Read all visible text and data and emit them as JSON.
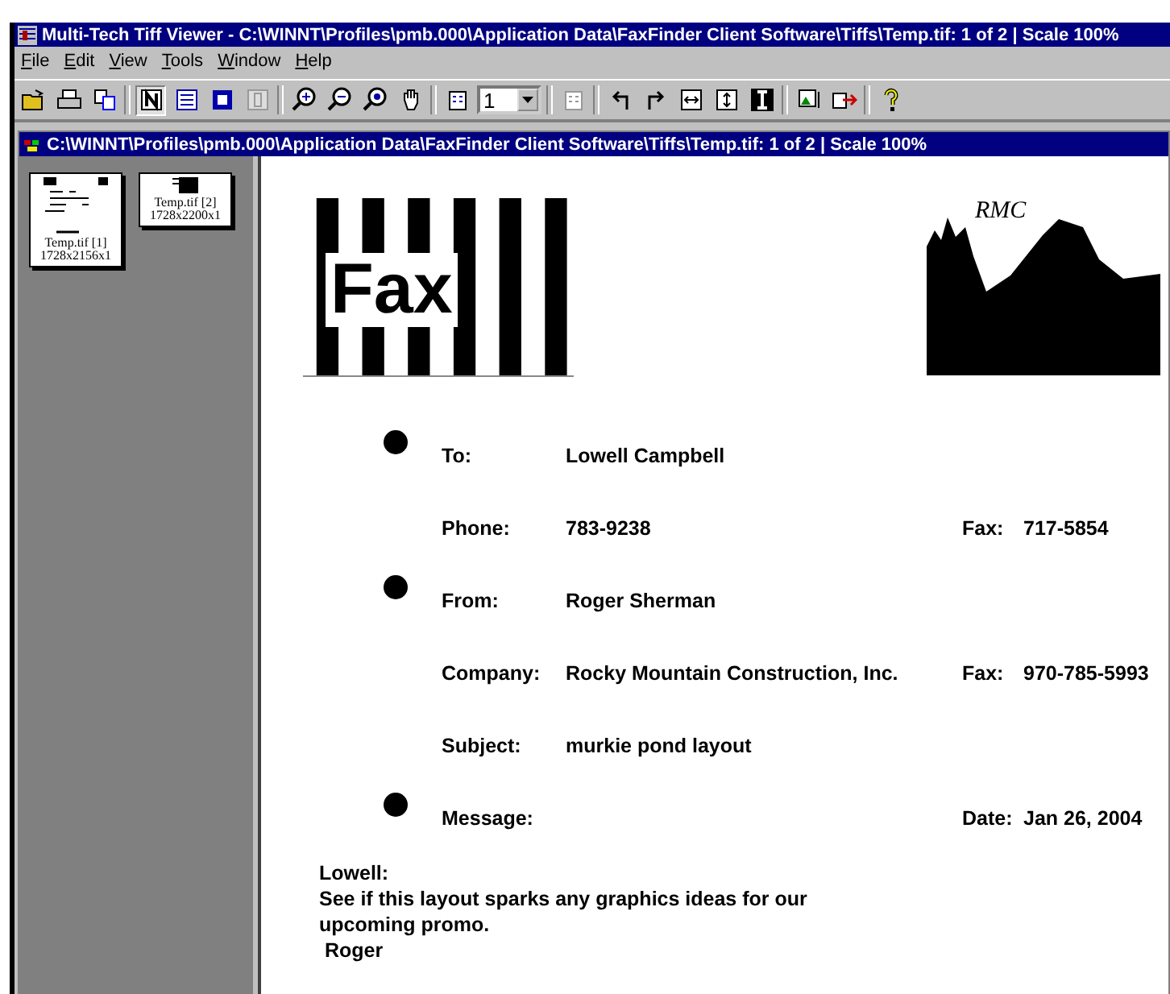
{
  "window": {
    "title": "Multi-Tech Tiff Viewer - C:\\WINNT\\Profiles\\pmb.000\\Application Data\\FaxFinder Client Software\\Tiffs\\Temp.tif: 1 of 2 | Scale 100%"
  },
  "menu": [
    "File",
    "Edit",
    "View",
    "Tools",
    "Window",
    "Help"
  ],
  "toolbar": [
    {
      "kind": "open"
    },
    {
      "kind": "print"
    },
    {
      "kind": "copy"
    },
    {
      "kind": "sep"
    },
    {
      "kind": "normal",
      "selected": true
    },
    {
      "kind": "fitwidth",
      "selected": false
    },
    {
      "kind": "fitpage",
      "selected": false
    },
    {
      "kind": "fitheight",
      "selected": false
    },
    {
      "kind": "sep"
    },
    {
      "kind": "zoomin"
    },
    {
      "kind": "zoomout"
    },
    {
      "kind": "zoomall"
    },
    {
      "kind": "hand"
    },
    {
      "kind": "sep"
    },
    {
      "kind": "pages"
    },
    {
      "kind": "combo",
      "value": "1"
    },
    {
      "kind": "sep"
    },
    {
      "kind": "pagesdisabled"
    },
    {
      "kind": "sep"
    },
    {
      "kind": "rotleft"
    },
    {
      "kind": "rotright"
    },
    {
      "kind": "fliph"
    },
    {
      "kind": "flipv"
    },
    {
      "kind": "invert"
    },
    {
      "kind": "sep"
    },
    {
      "kind": "image"
    },
    {
      "kind": "exit"
    },
    {
      "kind": "sep"
    },
    {
      "kind": "help"
    }
  ],
  "document_window": {
    "title": "C:\\WINNT\\Profiles\\pmb.000\\Application Data\\FaxFinder Client Software\\Tiffs\\Temp.tif: 1 of 2 | Scale 100%"
  },
  "thumbnails": [
    {
      "name": "Temp.tif [1]",
      "size": "1728x2156x1"
    },
    {
      "name": "Temp.tif [2]",
      "size": "1728x2200x1"
    }
  ],
  "page": {
    "logo": "Fax",
    "company_logo": "RMC",
    "fields": [
      {
        "bullet": true,
        "label": "To:",
        "value": "Lowell Campbell"
      },
      {
        "bullet": false,
        "label": "Phone:",
        "value": "783-9238",
        "right_label": "Fax:",
        "right_value": "717-5854"
      },
      {
        "bullet": true,
        "label": "From:",
        "value": "Roger Sherman"
      },
      {
        "bullet": false,
        "label": "Company:",
        "value": "Rocky Mountain Construction, Inc.",
        "right_label": "Fax:",
        "right_value": "970-785-5993"
      },
      {
        "bullet": false,
        "label": "Subject:",
        "value": "murkie pond layout"
      },
      {
        "bullet": true,
        "label": "Message:",
        "right_label": "Date:",
        "right_value": "Jan 26, 2004"
      }
    ],
    "message": [
      "Lowell:",
      "See if this layout sparks any graphics ideas for our",
      "upcoming promo.",
      " Roger"
    ]
  }
}
